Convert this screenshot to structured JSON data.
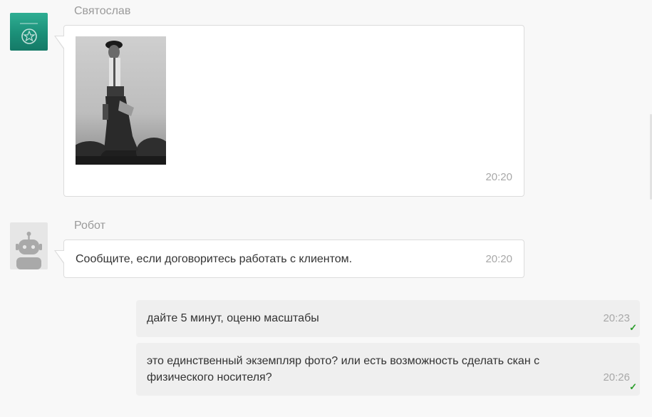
{
  "messages": [
    {
      "sender": "Святослав",
      "type": "image",
      "image_alt": "black-and-white vintage photo of a man in traditional dress",
      "time": "20:20"
    },
    {
      "sender": "Робот",
      "type": "text",
      "text": "Сообщите, если договоритесь работать с клиентом.",
      "time": "20:20"
    },
    {
      "type": "outgoing",
      "text": "дайте 5 минут, оценю масштабы",
      "time": "20:23",
      "status_icon": "check-icon"
    },
    {
      "type": "outgoing",
      "text_line1": "это единственный экземпляр фото? или есть возможность сделать скан с",
      "text_line2": "физического носителя?",
      "time": "20:26",
      "status_icon": "check-icon"
    }
  ],
  "colors": {
    "background": "#f8f8f8",
    "incoming_bubble": "#ffffff",
    "outgoing_bubble": "#efefef",
    "read_check": "#2a9d2a",
    "avatar_svyatoslav": "#1f9a80"
  }
}
